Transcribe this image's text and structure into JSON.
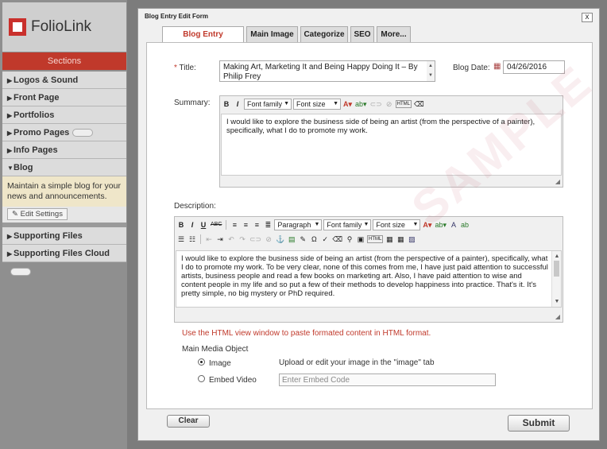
{
  "app": {
    "name": "FolioLink"
  },
  "sidebar": {
    "heading": "Sections",
    "items": [
      {
        "label": "Logos & Sound"
      },
      {
        "label": "Front Page"
      },
      {
        "label": "Portfolios"
      },
      {
        "label": "Promo Pages"
      },
      {
        "label": "Info Pages"
      },
      {
        "label": "Blog"
      }
    ],
    "blog_description": "Maintain a simple blog for your news and announcements.",
    "edit_settings": "Edit Settings",
    "items_lower": [
      {
        "label": "Supporting Files"
      },
      {
        "label": "Supporting Files Cloud"
      }
    ]
  },
  "modal": {
    "title": "Blog Entry Edit Form",
    "close": "x",
    "tabs": [
      {
        "label": "Blog Entry Properties",
        "active": true
      },
      {
        "label": "Main Image"
      },
      {
        "label": "Categorize"
      },
      {
        "label": "SEO"
      },
      {
        "label": "More..."
      }
    ]
  },
  "form": {
    "title_required": "*",
    "title_label": "Title:",
    "title_value": "Making Art, Marketing It and Being Happy Doing It – By Philip Frey",
    "date_label": "Blog Date:",
    "date_value": "04/26/2016",
    "summary_label": "Summary:",
    "summary_text": "I would like to explore the business side of being an artist (from the perspective of a painter), specifically, what I do to promote my work.",
    "description_label": "Description:",
    "description_text": "I would like to explore the business side of being an artist (from the perspective of a painter), specifically, what I do to promote my work. To be very clear, none of this comes from me, I have just paid attention to successful artists, business people and read a few books on marketing art. Also, I have paid attention to wise and content people in my life and so put a few of their methods to develop happiness into practice. That's it. It's pretty simple, no big mystery or PhD required.",
    "font_family": "Font family",
    "font_size": "Font size",
    "paragraph": "Paragraph",
    "html_hint": "Use the HTML view window to paste formated content in HTML format.",
    "main_media_label": "Main Media Object",
    "media_options": [
      {
        "label": "Image",
        "selected": true
      },
      {
        "label": "Embed Video"
      }
    ],
    "upload_note": "Upload or edit your image in the \"image\" tab",
    "embed_placeholder": "Enter Embed Code"
  },
  "buttons": {
    "clear": "Clear",
    "submit": "Submit"
  },
  "watermark": "SAMPLE"
}
